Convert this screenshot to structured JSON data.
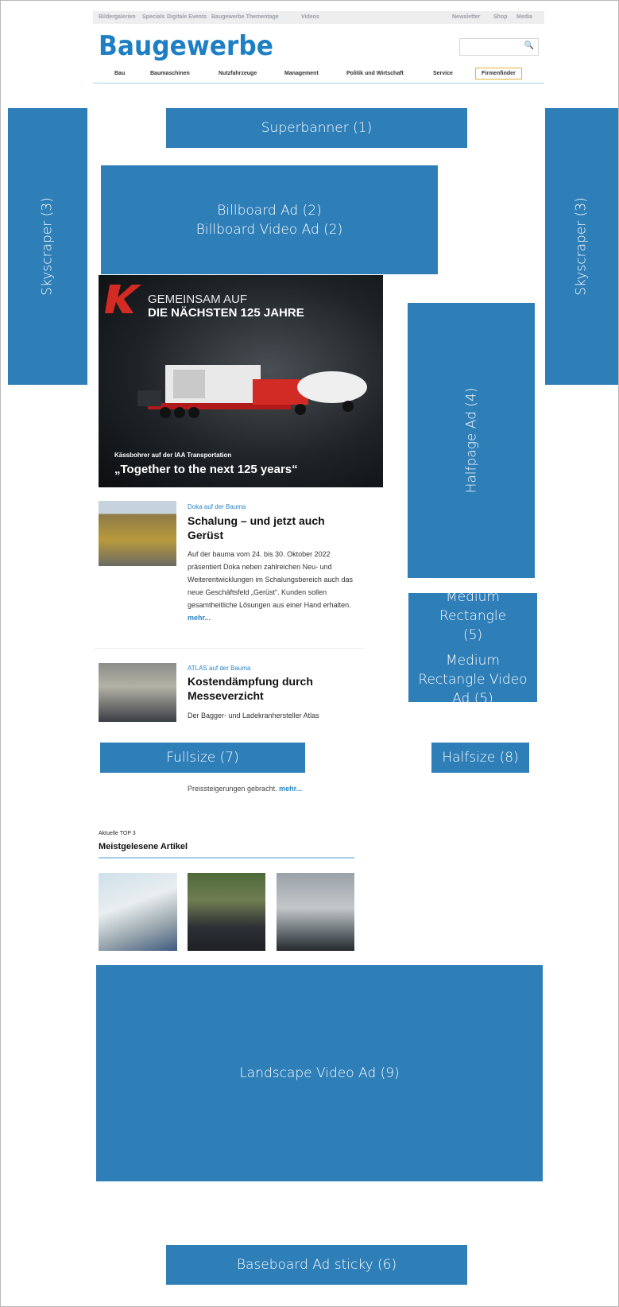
{
  "colors": {
    "ad_block": "#2e7eb8",
    "logo": "#1e7fc4",
    "link": "#2b85c3",
    "firmenfinder_border": "#e3b23c"
  },
  "top_nav": {
    "left": [
      "Bildergalerien",
      "Specials",
      "Digitale Events",
      "Baugewerbe Thementage",
      "Videos"
    ],
    "right": [
      "Newsletter",
      "Shop",
      "Media"
    ]
  },
  "logo": "Baugewerbe",
  "search": {
    "placeholder": "",
    "icon": "search-icon"
  },
  "main_nav": [
    "Bau",
    "Baumaschinen",
    "Nutzfahrzeuge",
    "Management",
    "Politik und Wirtschaft",
    "Service"
  ],
  "firmenfinder": "Firmenfinder",
  "ads": {
    "superbanner": "Superbanner (1)",
    "billboard": "Billboard Ad (2)",
    "billboard_video": "Billboard Video Ad (2)",
    "skyscraper": "Skyscraper (3)",
    "halfpage": "Halfpage Ad (4)",
    "medium_rectangle": "Medium Rectangle (5)",
    "medium_rectangle_video": "Medium Rectangle Video Ad (5)",
    "baseboard": "Baseboard Ad sticky (6)",
    "fullsize": "Fullsize (7)",
    "halfsize": "Halfsize (8)",
    "landscape_video": "Landscape Video Ad (9)"
  },
  "hero": {
    "line1": "GEMEINSAM AUF",
    "line2": "DIE NÄCHSTEN 125 JAHRE",
    "caption_small": "Kässbohrer auf der IAA Transportation",
    "caption_large": "„Together to the next 125 years“"
  },
  "articles": [
    {
      "kicker": "Doka auf der Bauma",
      "title": "Schalung – und jetzt auch Gerüst",
      "body": "Auf der bauma vom 24. bis 30. Oktober 2022 präsentiert Doka neben zahlreichen Neu- und Weiterentwicklungen im Schalungsbereich auch das neue Geschäftsfeld „Gerüst“. Kunden sollen gesamtheitliche Lösungen aus einer Hand erhalten.",
      "more": "mehr..."
    },
    {
      "kicker": "ATLAS auf der Bauma",
      "title": "Kostendämpfung durch Messeverzicht",
      "body": "Der Bagger- und Ladekranhersteller Atlas",
      "body_tail": "Preissteigerungen gebracht.",
      "more": "mehr..."
    }
  ],
  "top3": {
    "label": "Aktuelle TOP 3",
    "title": "Meistgelesene Artikel"
  }
}
